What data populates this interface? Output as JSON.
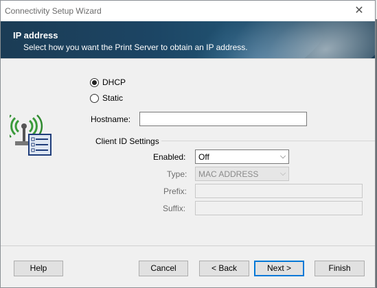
{
  "window": {
    "title": "Connectivity Setup Wizard",
    "close_glyph": "✕"
  },
  "banner": {
    "title": "IP address",
    "subtitle": "Select how you want the Print Server to obtain an IP address."
  },
  "address_mode": {
    "options": [
      {
        "label": "DHCP",
        "selected": true
      },
      {
        "label": "Static",
        "selected": false
      }
    ]
  },
  "hostname": {
    "label": "Hostname:",
    "value": ""
  },
  "client_id": {
    "group_label": "Client ID Settings",
    "enabled": {
      "label": "Enabled:",
      "value": "Off",
      "disabled": false
    },
    "type": {
      "label": "Type:",
      "value": "MAC ADDRESS",
      "disabled": true
    },
    "prefix": {
      "label": "Prefix:",
      "value": "",
      "disabled": true
    },
    "suffix": {
      "label": "Suffix:",
      "value": "",
      "disabled": true
    }
  },
  "buttons": {
    "help": "Help",
    "cancel": "Cancel",
    "back": "< Back",
    "next": "Next >",
    "finish": "Finish"
  },
  "icons": {
    "network": "wireless-network-settings-icon"
  },
  "colors": {
    "banner": "#1c4564",
    "accent": "#0078d7",
    "icon_green": "#3a9a3a"
  }
}
